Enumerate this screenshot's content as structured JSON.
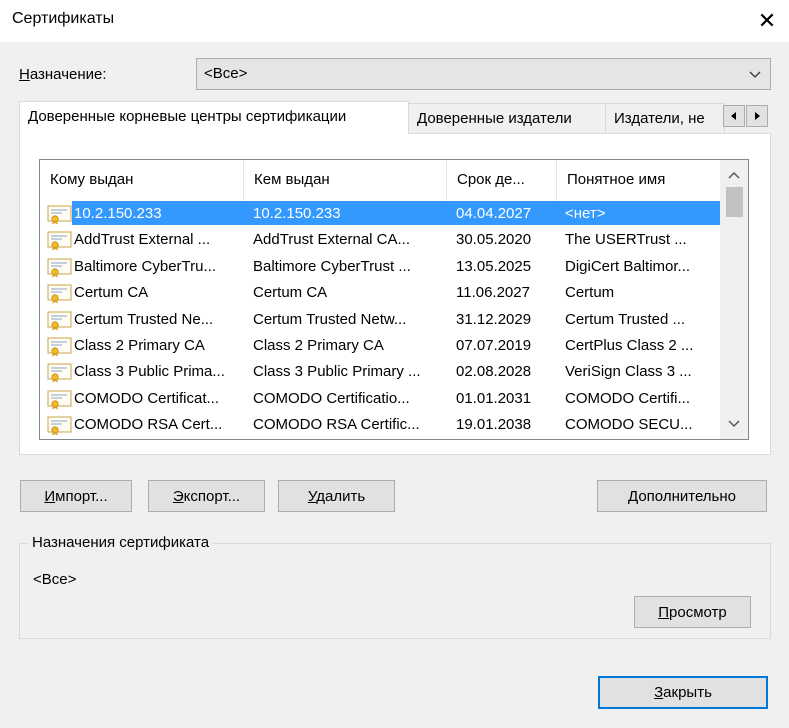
{
  "window": {
    "title": "Сертификаты"
  },
  "purpose": {
    "label": "Назначение:",
    "value": "<Все>"
  },
  "tabs": [
    {
      "label": "Доверенные корневые центры сертификации"
    },
    {
      "label": "Доверенные издатели"
    },
    {
      "label": "Издатели, не"
    }
  ],
  "columns": [
    "Кому выдан",
    "Кем выдан",
    "Срок де...",
    "Понятное имя"
  ],
  "rows": [
    {
      "issued_to": "10.2.150.233",
      "issued_by": "10.2.150.233",
      "expires": "04.04.2027",
      "friendly": "<нет>"
    },
    {
      "issued_to": "AddTrust External ...",
      "issued_by": "AddTrust External CA...",
      "expires": "30.05.2020",
      "friendly": "The USERTrust ..."
    },
    {
      "issued_to": "Baltimore CyberTru...",
      "issued_by": "Baltimore CyberTrust ...",
      "expires": "13.05.2025",
      "friendly": "DigiCert Baltimor..."
    },
    {
      "issued_to": "Certum CA",
      "issued_by": "Certum CA",
      "expires": "11.06.2027",
      "friendly": "Certum"
    },
    {
      "issued_to": "Certum Trusted Ne...",
      "issued_by": "Certum Trusted Netw...",
      "expires": "31.12.2029",
      "friendly": "Certum Trusted ..."
    },
    {
      "issued_to": "Class 2 Primary CA",
      "issued_by": "Class 2 Primary CA",
      "expires": "07.07.2019",
      "friendly": "CertPlus Class 2 ..."
    },
    {
      "issued_to": "Class 3 Public Prima...",
      "issued_by": "Class 3 Public Primary ...",
      "expires": "02.08.2028",
      "friendly": "VeriSign Class 3 ..."
    },
    {
      "issued_to": "COMODO Certificat...",
      "issued_by": "COMODO Certificatio...",
      "expires": "01.01.2031",
      "friendly": "COMODO Certifi..."
    },
    {
      "issued_to": "COMODO RSA Cert...",
      "issued_by": "COMODO RSA Certific...",
      "expires": "19.01.2038",
      "friendly": "COMODO SECU..."
    }
  ],
  "selected_row": 0,
  "buttons": {
    "import": "Импорт...",
    "export": "Экспорт...",
    "remove": "Удалить",
    "advanced": "Дополнительно",
    "view": "Просмотр",
    "close": "Закрыть"
  },
  "cert_purposes": {
    "title": "Назначения сертификата",
    "value": "<Все>"
  },
  "colors": {
    "selection": "#3399ff",
    "accent": "#0078d7"
  }
}
